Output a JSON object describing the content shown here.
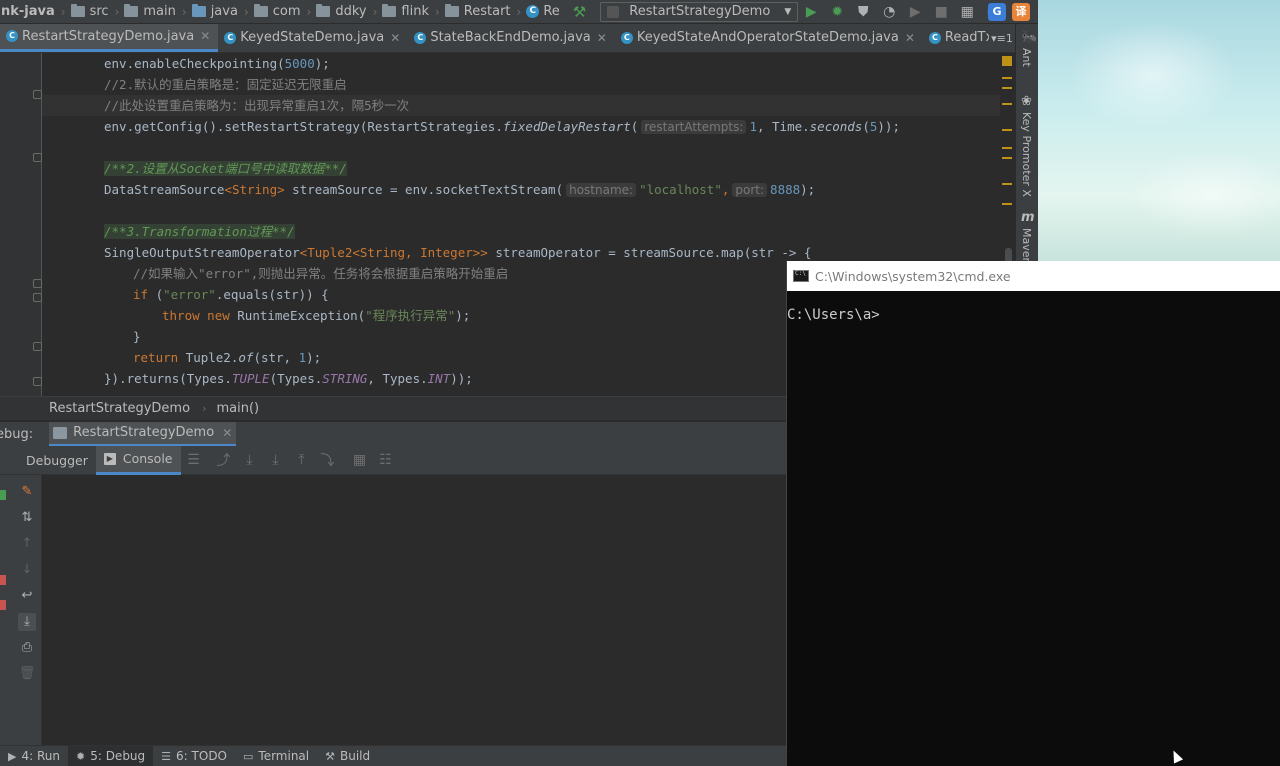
{
  "topbar": {
    "breadcrumbs": [
      "nk-java",
      "src",
      "main",
      "java",
      "com",
      "ddky",
      "flink",
      "Restart",
      "Re"
    ],
    "run_config": "RestartStrategyDemo"
  },
  "tabs": [
    {
      "label": "RestartStrategyDemo.java",
      "active": true
    },
    {
      "label": "KeyedStateDemo.java",
      "active": false
    },
    {
      "label": "StateBackEndDemo.java",
      "active": false
    },
    {
      "label": "KeyedStateAndOperatorStateDemo.java",
      "active": false
    },
    {
      "label": "ReadTxtConten",
      "active": false
    }
  ],
  "tabs_more": "▾≡1",
  "code": {
    "line1": {
      "a": "env.enableCheckpointing(",
      "num": "5000",
      "b": ");"
    },
    "line2": "//2.默认的重启策略是：固定延迟无限重启",
    "line3": "//此处设置重启策略为：出现异常重启1次，隔5秒一次",
    "line4": {
      "a": "env.getConfig().setRestartStrategy(RestartStrategies.",
      "method": "fixedDelayRestart",
      "b": "(",
      "hint": "restartAttempts:",
      "num": "1",
      "c": ", Time.",
      "method2": "seconds",
      "d": "(",
      "num2": "5",
      "e": "));"
    },
    "line6": "/**2.设置从Socket端口号中读取数据**/",
    "line7": {
      "a": "DataStreamSource",
      "b": "<String>",
      "c": " streamSource = env.socketTextStream(",
      "hint1": "hostname:",
      "str": "\"localhost\"",
      "d": ",",
      "hint2": "port:",
      "num": "8888",
      "e": ");"
    },
    "line9": "/**3.Transformation过程**/",
    "line10": {
      "a": "SingleOutputStreamOperator",
      "b": "<Tuple2<String, Integer>>",
      "c": " streamOperator = streamSource.map(str -> {"
    },
    "line11": {
      "cmt_a": "//如果输入",
      "str": "\"error\"",
      "cmt_b": ",则抛出异常。任务将会根据重启策略开始重启"
    },
    "line12": {
      "kw": "if",
      "a": " (",
      "str": "\"error\"",
      "b": ".equals(str)) {"
    },
    "line13": {
      "kw1": "throw",
      "kw2": "new",
      "a": " RuntimeException(",
      "str": "\"程序执行异常\"",
      "b": ");"
    },
    "line14": "}",
    "line15": {
      "kw": "return",
      "a": " Tuple2.",
      "method": "of",
      "b": "(str, ",
      "num": "1",
      "c": ");"
    },
    "line16": {
      "a": "}).returns(Types.",
      "f1": "TUPLE",
      "b": "(Types.",
      "f2": "STRING",
      "c": ", Types.",
      "f3": "INT",
      "d": "));"
    }
  },
  "navbar": {
    "class": "RestartStrategyDemo",
    "method": "main()"
  },
  "right_strip": {
    "ant": "Ant",
    "key_promoter": "Key Promoter X",
    "maven": "Maven"
  },
  "debug": {
    "label": "ebug:",
    "session": "RestartStrategyDemo",
    "tab_debugger": "Debugger",
    "tab_console": "Console"
  },
  "bottombar": {
    "run": "4: Run",
    "debug": "5: Debug",
    "todo": "6: TODO",
    "terminal": "Terminal",
    "build": "Build"
  },
  "cmd": {
    "title": "C:\\Windows\\system32\\cmd.exe",
    "prompt": "C:\\Users\\a>"
  },
  "colors": {
    "editor_bg": "#2b2b2b",
    "panel_bg": "#3c3f41",
    "accent": "#4a88c7",
    "cmd_bg": "#0c0c0c"
  }
}
